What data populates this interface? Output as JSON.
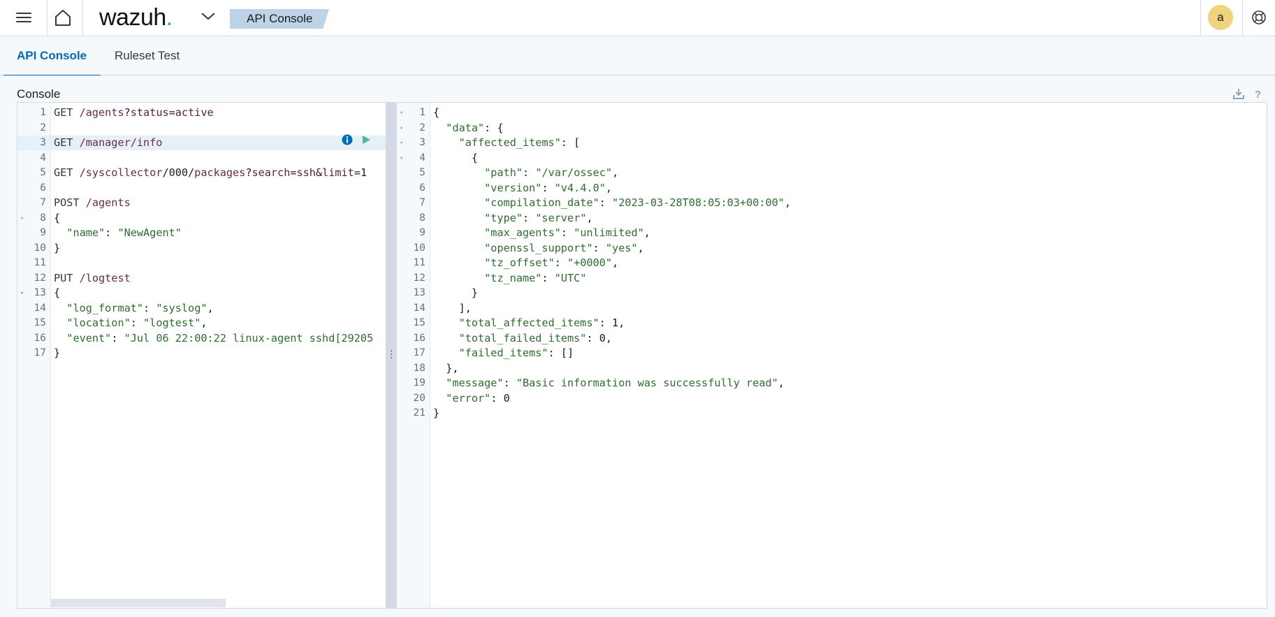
{
  "header": {
    "logo_text": "wazuh",
    "logo_dot": ".",
    "breadcrumb": "API Console",
    "avatar_letter": "a",
    "icons": {
      "menu": "hamburger-icon",
      "home": "home-icon",
      "app_switch": "chevron-down-icon",
      "help": "lifebuoy-icon"
    }
  },
  "tabs": [
    {
      "label": "API Console",
      "active": true
    },
    {
      "label": "Ruleset Test",
      "active": false
    }
  ],
  "console": {
    "title": "Console",
    "tools": {
      "download": "download-icon",
      "help": "question-icon"
    }
  },
  "request_editor": {
    "lines": [
      {
        "n": "1",
        "segs": [
          [
            "m",
            "GET "
          ],
          [
            "u",
            "/agents"
          ],
          [
            "p",
            "?"
          ],
          [
            "k",
            "status"
          ],
          [
            "p",
            "="
          ],
          [
            "k",
            "active"
          ]
        ]
      },
      {
        "n": "2",
        "segs": []
      },
      {
        "n": "3",
        "segs": [
          [
            "m",
            "GET "
          ],
          [
            "u",
            "/manager/info"
          ]
        ],
        "highlight": true
      },
      {
        "n": "4",
        "segs": []
      },
      {
        "n": "5",
        "segs": [
          [
            "m",
            "GET "
          ],
          [
            "u",
            "/syscollector"
          ],
          [
            "p",
            "/000/"
          ],
          [
            "u",
            "packages"
          ],
          [
            "p",
            "?"
          ],
          [
            "k",
            "search"
          ],
          [
            "p",
            "="
          ],
          [
            "k",
            "ssh"
          ],
          [
            "p",
            "&"
          ],
          [
            "k",
            "limit"
          ],
          [
            "p",
            "=1"
          ]
        ]
      },
      {
        "n": "6",
        "segs": []
      },
      {
        "n": "7",
        "segs": [
          [
            "m",
            "POST "
          ],
          [
            "u",
            "/agents"
          ]
        ]
      },
      {
        "n": "8",
        "segs": [
          [
            "p",
            "{"
          ]
        ],
        "fold": true
      },
      {
        "n": "9",
        "segs": [
          [
            "p",
            "  "
          ],
          [
            "s",
            "\"name\""
          ],
          [
            "p",
            ": "
          ],
          [
            "s",
            "\"NewAgent\""
          ]
        ]
      },
      {
        "n": "10",
        "segs": [
          [
            "p",
            "}"
          ]
        ]
      },
      {
        "n": "11",
        "segs": []
      },
      {
        "n": "12",
        "segs": [
          [
            "m",
            "PUT "
          ],
          [
            "u",
            "/logtest"
          ]
        ]
      },
      {
        "n": "13",
        "segs": [
          [
            "p",
            "{"
          ]
        ],
        "fold": true
      },
      {
        "n": "14",
        "segs": [
          [
            "p",
            "  "
          ],
          [
            "s",
            "\"log_format\""
          ],
          [
            "p",
            ": "
          ],
          [
            "s",
            "\"syslog\""
          ],
          [
            "p",
            ","
          ]
        ]
      },
      {
        "n": "15",
        "segs": [
          [
            "p",
            "  "
          ],
          [
            "s",
            "\"location\""
          ],
          [
            "p",
            ": "
          ],
          [
            "s",
            "\"logtest\""
          ],
          [
            "p",
            ","
          ]
        ]
      },
      {
        "n": "16",
        "segs": [
          [
            "p",
            "  "
          ],
          [
            "s",
            "\"event\""
          ],
          [
            "p",
            ": "
          ],
          [
            "s",
            "\"Jul 06 22:00:22 linux-agent sshd[29205"
          ]
        ]
      },
      {
        "n": "17",
        "segs": [
          [
            "p",
            "}"
          ]
        ]
      }
    ],
    "row_actions": {
      "info": "info-icon",
      "run": "play-icon"
    }
  },
  "response_editor": {
    "lines": [
      {
        "n": "1",
        "segs": [
          [
            "p",
            "{"
          ]
        ],
        "fold": true
      },
      {
        "n": "2",
        "segs": [
          [
            "p",
            "  "
          ],
          [
            "s",
            "\"data\""
          ],
          [
            "p",
            ": {"
          ]
        ],
        "fold": true
      },
      {
        "n": "3",
        "segs": [
          [
            "p",
            "    "
          ],
          [
            "s",
            "\"affected_items\""
          ],
          [
            "p",
            ": ["
          ]
        ],
        "fold": true
      },
      {
        "n": "4",
        "segs": [
          [
            "p",
            "      {"
          ]
        ],
        "fold": true
      },
      {
        "n": "5",
        "segs": [
          [
            "p",
            "        "
          ],
          [
            "s",
            "\"path\""
          ],
          [
            "p",
            ": "
          ],
          [
            "s",
            "\"/var/ossec\""
          ],
          [
            "p",
            ","
          ]
        ]
      },
      {
        "n": "6",
        "segs": [
          [
            "p",
            "        "
          ],
          [
            "s",
            "\"version\""
          ],
          [
            "p",
            ": "
          ],
          [
            "s",
            "\"v4.4.0\""
          ],
          [
            "p",
            ","
          ]
        ]
      },
      {
        "n": "7",
        "segs": [
          [
            "p",
            "        "
          ],
          [
            "s",
            "\"compilation_date\""
          ],
          [
            "p",
            ": "
          ],
          [
            "s",
            "\"2023-03-28T08:05:03+00:00\""
          ],
          [
            "p",
            ","
          ]
        ]
      },
      {
        "n": "8",
        "segs": [
          [
            "p",
            "        "
          ],
          [
            "s",
            "\"type\""
          ],
          [
            "p",
            ": "
          ],
          [
            "s",
            "\"server\""
          ],
          [
            "p",
            ","
          ]
        ]
      },
      {
        "n": "9",
        "segs": [
          [
            "p",
            "        "
          ],
          [
            "s",
            "\"max_agents\""
          ],
          [
            "p",
            ": "
          ],
          [
            "s",
            "\"unlimited\""
          ],
          [
            "p",
            ","
          ]
        ]
      },
      {
        "n": "10",
        "segs": [
          [
            "p",
            "        "
          ],
          [
            "s",
            "\"openssl_support\""
          ],
          [
            "p",
            ": "
          ],
          [
            "s",
            "\"yes\""
          ],
          [
            "p",
            ","
          ]
        ]
      },
      {
        "n": "11",
        "segs": [
          [
            "p",
            "        "
          ],
          [
            "s",
            "\"tz_offset\""
          ],
          [
            "p",
            ": "
          ],
          [
            "s",
            "\"+0000\""
          ],
          [
            "p",
            ","
          ]
        ]
      },
      {
        "n": "12",
        "segs": [
          [
            "p",
            "        "
          ],
          [
            "s",
            "\"tz_name\""
          ],
          [
            "p",
            ": "
          ],
          [
            "s",
            "\"UTC\""
          ]
        ]
      },
      {
        "n": "13",
        "segs": [
          [
            "p",
            "      }"
          ]
        ]
      },
      {
        "n": "14",
        "segs": [
          [
            "p",
            "    ],"
          ]
        ]
      },
      {
        "n": "15",
        "segs": [
          [
            "p",
            "    "
          ],
          [
            "s",
            "\"total_affected_items\""
          ],
          [
            "p",
            ": 1,"
          ]
        ]
      },
      {
        "n": "16",
        "segs": [
          [
            "p",
            "    "
          ],
          [
            "s",
            "\"total_failed_items\""
          ],
          [
            "p",
            ": 0,"
          ]
        ]
      },
      {
        "n": "17",
        "segs": [
          [
            "p",
            "    "
          ],
          [
            "s",
            "\"failed_items\""
          ],
          [
            "p",
            ": []"
          ]
        ]
      },
      {
        "n": "18",
        "segs": [
          [
            "p",
            "  },"
          ]
        ]
      },
      {
        "n": "19",
        "segs": [
          [
            "p",
            "  "
          ],
          [
            "s",
            "\"message\""
          ],
          [
            "p",
            ": "
          ],
          [
            "s",
            "\"Basic information was successfully read\""
          ],
          [
            "p",
            ","
          ]
        ]
      },
      {
        "n": "20",
        "segs": [
          [
            "p",
            "  "
          ],
          [
            "s",
            "\"error\""
          ],
          [
            "p",
            ": 0"
          ]
        ]
      },
      {
        "n": "21",
        "segs": [
          [
            "p",
            "}"
          ]
        ]
      }
    ]
  },
  "colors": {
    "accent": "#006bb8",
    "crumb_bg": "#bcd3e8",
    "avatar_bg": "#f0d37d",
    "run_green": "#54b399",
    "info_blue": "#006bb8"
  }
}
